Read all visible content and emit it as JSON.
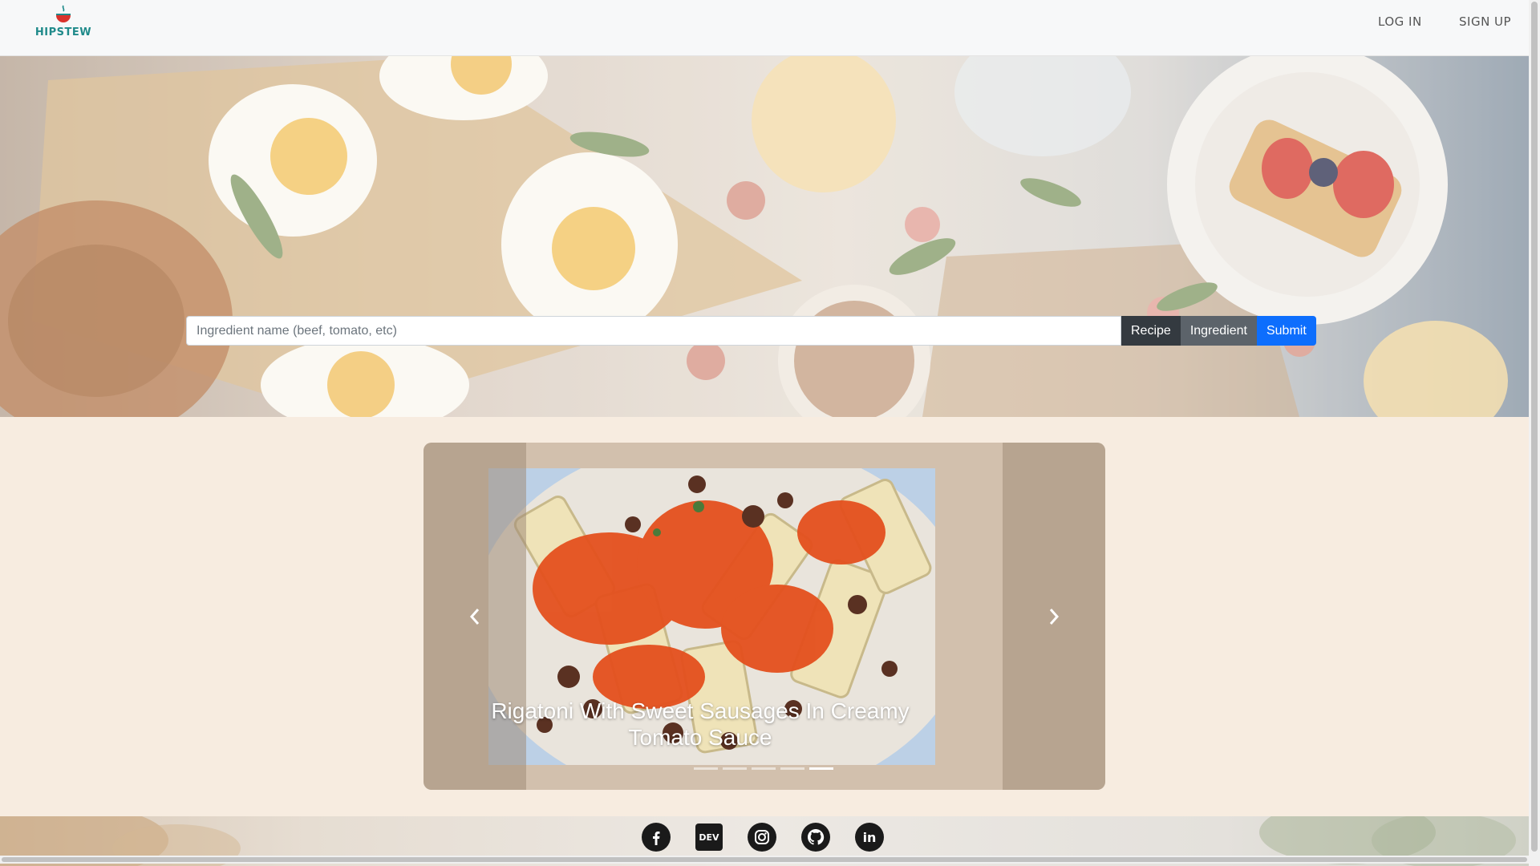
{
  "nav": {
    "brand": "HIPSTEW",
    "login": "LOG IN",
    "signup": "SIGN UP"
  },
  "search": {
    "placeholder": "Ingredient name (beef, tomato, etc)",
    "value": "",
    "recipe_label": "Recipe",
    "ingredient_label": "Ingredient",
    "submit_label": "Submit"
  },
  "carousel": {
    "caption": "Rigatoni With Sweet Sausages In Creamy Tomato Sauce",
    "slide_count": 5,
    "active_index": 4,
    "prev_icon": "chevron-left-icon",
    "next_icon": "chevron-right-icon"
  },
  "footer": {
    "socials": [
      {
        "name": "facebook-icon"
      },
      {
        "name": "dev-icon",
        "label": "DEV"
      },
      {
        "name": "instagram-icon"
      },
      {
        "name": "github-icon"
      },
      {
        "name": "linkedin-icon",
        "label": "in"
      }
    ]
  },
  "colors": {
    "brand": "#1f8a8a",
    "submit": "#0d6efd",
    "recipe": "#343a40",
    "ingredient": "#5c636a",
    "page_bg": "#f7ece0"
  }
}
